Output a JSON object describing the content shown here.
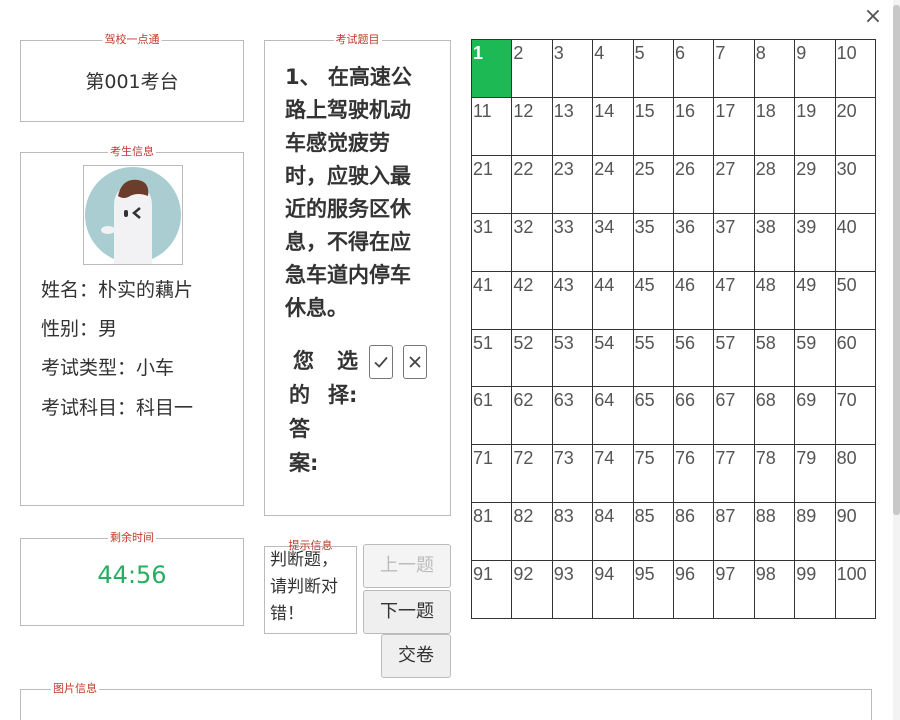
{
  "window": {
    "close_glyph": "×"
  },
  "school_panel": {
    "legend": "驾校一点通",
    "value": "第001考台"
  },
  "candidate_panel": {
    "legend": "考生信息",
    "name": "姓名：朴实的藕片",
    "gender": "性别：男",
    "exam_type": "考试类型：小车",
    "exam_subject": "考试科目：科目一"
  },
  "time_panel": {
    "legend": "剩余时间",
    "remaining": "44:56"
  },
  "question_panel": {
    "legend": "考试题目",
    "text": "1、 在高速公路上驾驶机动车感觉疲劳时，应驶入最近的服务区休息，不得在应急车道内停车休息。",
    "answer_label_chars": [
      "您",
      "选",
      "的",
      "择:",
      "答",
      "案:"
    ],
    "correct_icon": "check-icon",
    "wrong_icon": "cross-icon"
  },
  "hint_panel": {
    "legend": "提示信息",
    "text": "判断题，请判断对错！"
  },
  "buttons": {
    "prev": "上一题",
    "next": "下一题",
    "submit": "交卷"
  },
  "image_panel": {
    "legend": "图片信息"
  },
  "question_grid": {
    "current": 1,
    "current_color": "#1db954",
    "numbers": [
      "1",
      "2",
      "3",
      "4",
      "5",
      "6",
      "7",
      "8",
      "9",
      "10",
      "11",
      "12",
      "13",
      "14",
      "15",
      "16",
      "17",
      "18",
      "19",
      "20",
      "21",
      "22",
      "23",
      "24",
      "25",
      "26",
      "27",
      "28",
      "29",
      "30",
      "31",
      "32",
      "33",
      "34",
      "35",
      "36",
      "37",
      "38",
      "39",
      "40",
      "41",
      "42",
      "43",
      "44",
      "45",
      "46",
      "47",
      "48",
      "49",
      "50",
      "51",
      "52",
      "53",
      "54",
      "55",
      "56",
      "57",
      "58",
      "59",
      "60",
      "61",
      "62",
      "63",
      "64",
      "65",
      "66",
      "67",
      "68",
      "69",
      "70",
      "71",
      "72",
      "73",
      "74",
      "75",
      "76",
      "77",
      "78",
      "79",
      "80",
      "81",
      "82",
      "83",
      "84",
      "85",
      "86",
      "87",
      "88",
      "89",
      "90",
      "91",
      "92",
      "93",
      "94",
      "95",
      "96",
      "97",
      "98",
      "99",
      "100"
    ]
  },
  "colors": {
    "legend": "#c0392b",
    "timer": "#27ae60",
    "current_cell": "#1db954"
  }
}
